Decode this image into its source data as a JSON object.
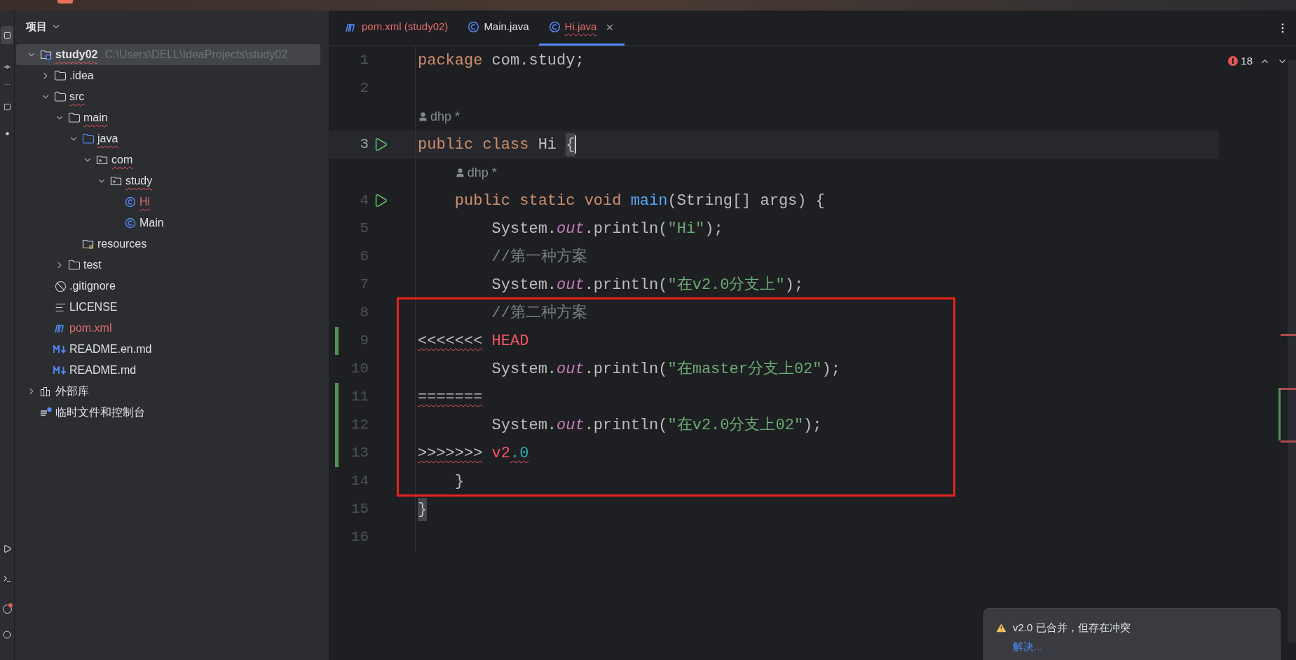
{
  "project_panel": {
    "title": "项目",
    "tree": [
      {
        "label": "study02",
        "path": "C:\\Users\\DELL\\IdeaProjects\\study02",
        "kind": "module",
        "expanded": true,
        "selected": true,
        "error": true,
        "conflict": false,
        "children": [
          {
            "label": ".idea",
            "kind": "folder",
            "expanded": false,
            "selected": false,
            "error": false,
            "conflict": false
          },
          {
            "label": "src",
            "kind": "folder",
            "expanded": true,
            "selected": false,
            "error": true,
            "conflict": false,
            "children": [
              {
                "label": "main",
                "kind": "folder",
                "expanded": true,
                "selected": false,
                "error": true,
                "conflict": false,
                "children": [
                  {
                    "label": "java",
                    "kind": "source_folder",
                    "expanded": true,
                    "selected": false,
                    "error": true,
                    "conflict": false,
                    "children": [
                      {
                        "label": "com",
                        "kind": "package",
                        "expanded": true,
                        "selected": false,
                        "error": true,
                        "conflict": false,
                        "children": [
                          {
                            "label": "study",
                            "kind": "package",
                            "expanded": true,
                            "selected": false,
                            "error": true,
                            "conflict": false,
                            "children": [
                              {
                                "label": "Hi",
                                "kind": "class",
                                "selected": false,
                                "error": true,
                                "conflict": true
                              },
                              {
                                "label": "Main",
                                "kind": "class",
                                "selected": false,
                                "error": false,
                                "conflict": false
                              }
                            ]
                          }
                        ]
                      }
                    ]
                  },
                  {
                    "label": "resources",
                    "kind": "resources",
                    "selected": false,
                    "error": false,
                    "conflict": false
                  }
                ]
              },
              {
                "label": "test",
                "kind": "folder",
                "expanded": false,
                "selected": false,
                "error": false,
                "conflict": false
              }
            ]
          },
          {
            "label": ".gitignore",
            "kind": "ignore",
            "selected": false,
            "error": false,
            "conflict": false
          },
          {
            "label": "LICENSE",
            "kind": "text",
            "selected": false,
            "error": false,
            "conflict": false
          },
          {
            "label": "pom.xml",
            "kind": "maven",
            "selected": false,
            "error": false,
            "conflict": true
          },
          {
            "label": "README.en.md",
            "kind": "markdown",
            "selected": false,
            "error": false,
            "conflict": false
          },
          {
            "label": "README.md",
            "kind": "markdown",
            "selected": false,
            "error": false,
            "conflict": false
          }
        ]
      },
      {
        "label": "外部库",
        "kind": "library",
        "expanded": false,
        "selected": false,
        "error": false,
        "conflict": false
      },
      {
        "label": "临时文件和控制台",
        "kind": "scratch",
        "selected": false,
        "error": false,
        "conflict": false
      }
    ]
  },
  "tabs": [
    {
      "label": "pom.xml (study02)",
      "kind": "maven",
      "conflict": true,
      "error": false,
      "selected": false
    },
    {
      "label": "Main.java",
      "kind": "class",
      "conflict": false,
      "error": false,
      "selected": false
    },
    {
      "label": "Hi.java",
      "kind": "class",
      "conflict": true,
      "error": true,
      "selected": true
    }
  ],
  "problems": {
    "count": "18"
  },
  "lines": [
    {
      "kind": "code",
      "number": "1",
      "current": false,
      "changed": false,
      "boxed": false,
      "run": false,
      "tokens": [
        {
          "text": "package",
          "kind": "keyword"
        },
        {
          "text": " com.study;",
          "kind": "plain"
        }
      ]
    },
    {
      "kind": "code",
      "number": "2",
      "current": false,
      "changed": false,
      "boxed": false,
      "run": false
    },
    {
      "kind": "hint",
      "text": "dhp *"
    },
    {
      "kind": "code",
      "number": "3",
      "current": true,
      "changed": false,
      "boxed": false,
      "run": true,
      "tokens": [
        {
          "text": "public class ",
          "kind": "keyword"
        },
        {
          "text": "Hi ",
          "kind": "plain"
        },
        {
          "text": "{",
          "kind": "brace",
          "caret": true
        }
      ]
    },
    {
      "kind": "hint",
      "text": "dhp *"
    },
    {
      "kind": "code",
      "number": "4",
      "current": false,
      "changed": false,
      "boxed": false,
      "run": true,
      "tokens": [
        {
          "text": "    public static void ",
          "kind": "keyword"
        },
        {
          "text": "main",
          "kind": "method"
        },
        {
          "text": "(String[] args) {",
          "kind": "plain"
        }
      ]
    },
    {
      "kind": "code",
      "number": "5",
      "current": false,
      "changed": false,
      "boxed": false,
      "run": false,
      "tokens": [
        {
          "text": "        System.",
          "kind": "plain"
        },
        {
          "text": "out",
          "kind": "field"
        },
        {
          "text": ".println(",
          "kind": "plain"
        },
        {
          "text": "\"Hi\"",
          "kind": "string"
        },
        {
          "text": ");",
          "kind": "plain"
        }
      ]
    },
    {
      "kind": "code",
      "number": "6",
      "current": false,
      "changed": false,
      "boxed": false,
      "run": false,
      "tokens": [
        {
          "text": "        //第一种方案",
          "kind": "comment"
        }
      ]
    },
    {
      "kind": "code",
      "number": "7",
      "current": false,
      "changed": false,
      "boxed": false,
      "run": false,
      "tokens": [
        {
          "text": "        System.",
          "kind": "plain"
        },
        {
          "text": "out",
          "kind": "field"
        },
        {
          "text": ".println(",
          "kind": "plain"
        },
        {
          "text": "\"在v2.0分支上\"",
          "kind": "string"
        },
        {
          "text": ");",
          "kind": "plain"
        }
      ]
    },
    {
      "kind": "code",
      "number": "8",
      "current": false,
      "changed": false,
      "boxed": true,
      "run": false,
      "tokens": [
        {
          "text": "        //第二种方案",
          "kind": "comment"
        }
      ]
    },
    {
      "kind": "code",
      "number": "9",
      "current": false,
      "changed": true,
      "boxed": true,
      "run": false,
      "tokens": [
        {
          "text": "<<<<<<<",
          "kind": "marker",
          "error": true
        },
        {
          "text": " HEAD",
          "kind": "label"
        }
      ]
    },
    {
      "kind": "code",
      "number": "10",
      "current": false,
      "changed": false,
      "boxed": true,
      "run": false,
      "tokens": [
        {
          "text": "        System.",
          "kind": "plain"
        },
        {
          "text": "out",
          "kind": "field"
        },
        {
          "text": ".println(",
          "kind": "plain"
        },
        {
          "text": "\"在master分支上02\"",
          "kind": "string"
        },
        {
          "text": ");",
          "kind": "plain"
        }
      ]
    },
    {
      "kind": "code",
      "number": "11",
      "current": false,
      "changed": true,
      "boxed": true,
      "run": false,
      "tokens": [
        {
          "text": "=======",
          "kind": "marker",
          "error": true
        }
      ]
    },
    {
      "kind": "code",
      "number": "12",
      "current": false,
      "changed": true,
      "boxed": true,
      "run": false,
      "tokens": [
        {
          "text": "        System.",
          "kind": "plain"
        },
        {
          "text": "out",
          "kind": "field"
        },
        {
          "text": ".println(",
          "kind": "plain"
        },
        {
          "text": "\"在v2.0分支上02\"",
          "kind": "string"
        },
        {
          "text": ");",
          "kind": "plain"
        }
      ]
    },
    {
      "kind": "code",
      "number": "13",
      "current": false,
      "changed": true,
      "boxed": true,
      "run": false,
      "tokens": [
        {
          "text": ">>>>>>>",
          "kind": "marker",
          "error": true
        },
        {
          "text": " v2",
          "kind": "label"
        },
        {
          "text": ".0",
          "kind": "number",
          "error": true
        }
      ]
    },
    {
      "kind": "code",
      "number": "14",
      "current": false,
      "changed": false,
      "boxed": true,
      "run": false,
      "tokens": [
        {
          "text": "    }",
          "kind": "plain"
        }
      ]
    },
    {
      "kind": "code",
      "number": "15",
      "current": false,
      "changed": false,
      "boxed": false,
      "run": false,
      "tokens": [
        {
          "text": "}",
          "kind": "brace",
          "caret": false
        }
      ]
    },
    {
      "kind": "code",
      "number": "16",
      "current": false,
      "changed": false,
      "boxed": false,
      "run": false
    }
  ],
  "notification": {
    "message": "v2.0 已合并，但存在冲突",
    "action": "解决..."
  }
}
